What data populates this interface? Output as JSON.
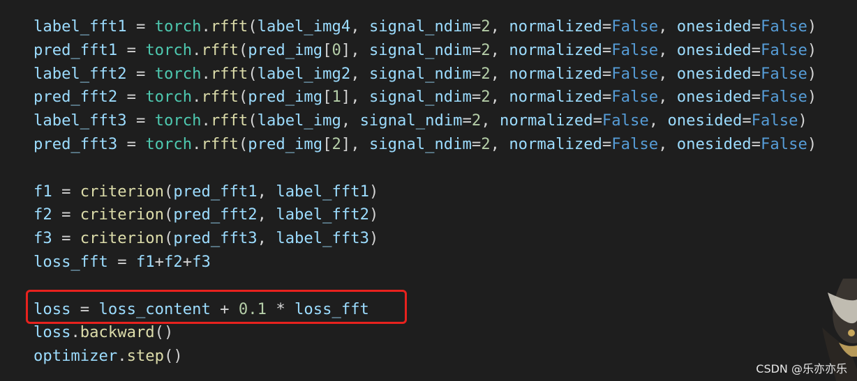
{
  "code": {
    "lines": [
      {
        "tokens": [
          {
            "t": "label_fft1",
            "k": "var"
          },
          {
            "t": " = ",
            "k": "op"
          },
          {
            "t": "torch",
            "k": "mod"
          },
          {
            "t": ".",
            "k": "op"
          },
          {
            "t": "rfft",
            "k": "fn"
          },
          {
            "t": "(",
            "k": "op"
          },
          {
            "t": "label_img4",
            "k": "var"
          },
          {
            "t": ", ",
            "k": "op"
          },
          {
            "t": "signal_ndim",
            "k": "var"
          },
          {
            "t": "=",
            "k": "op"
          },
          {
            "t": "2",
            "k": "num"
          },
          {
            "t": ", ",
            "k": "op"
          },
          {
            "t": "normalized",
            "k": "var"
          },
          {
            "t": "=",
            "k": "op"
          },
          {
            "t": "False",
            "k": "kw"
          },
          {
            "t": ", ",
            "k": "op"
          },
          {
            "t": "onesided",
            "k": "var"
          },
          {
            "t": "=",
            "k": "op"
          },
          {
            "t": "False",
            "k": "kw"
          },
          {
            "t": ")",
            "k": "op"
          }
        ]
      },
      {
        "tokens": [
          {
            "t": "pred_fft1",
            "k": "var"
          },
          {
            "t": " = ",
            "k": "op"
          },
          {
            "t": "torch",
            "k": "mod"
          },
          {
            "t": ".",
            "k": "op"
          },
          {
            "t": "rfft",
            "k": "fn"
          },
          {
            "t": "(",
            "k": "op"
          },
          {
            "t": "pred_img",
            "k": "var"
          },
          {
            "t": "[",
            "k": "op"
          },
          {
            "t": "0",
            "k": "num"
          },
          {
            "t": "], ",
            "k": "op"
          },
          {
            "t": "signal_ndim",
            "k": "var"
          },
          {
            "t": "=",
            "k": "op"
          },
          {
            "t": "2",
            "k": "num"
          },
          {
            "t": ", ",
            "k": "op"
          },
          {
            "t": "normalized",
            "k": "var"
          },
          {
            "t": "=",
            "k": "op"
          },
          {
            "t": "False",
            "k": "kw"
          },
          {
            "t": ", ",
            "k": "op"
          },
          {
            "t": "onesided",
            "k": "var"
          },
          {
            "t": "=",
            "k": "op"
          },
          {
            "t": "False",
            "k": "kw"
          },
          {
            "t": ")",
            "k": "op"
          }
        ]
      },
      {
        "tokens": [
          {
            "t": "label_fft2",
            "k": "var"
          },
          {
            "t": " = ",
            "k": "op"
          },
          {
            "t": "torch",
            "k": "mod"
          },
          {
            "t": ".",
            "k": "op"
          },
          {
            "t": "rfft",
            "k": "fn"
          },
          {
            "t": "(",
            "k": "op"
          },
          {
            "t": "label_img2",
            "k": "var"
          },
          {
            "t": ", ",
            "k": "op"
          },
          {
            "t": "signal_ndim",
            "k": "var"
          },
          {
            "t": "=",
            "k": "op"
          },
          {
            "t": "2",
            "k": "num"
          },
          {
            "t": ", ",
            "k": "op"
          },
          {
            "t": "normalized",
            "k": "var"
          },
          {
            "t": "=",
            "k": "op"
          },
          {
            "t": "False",
            "k": "kw"
          },
          {
            "t": ", ",
            "k": "op"
          },
          {
            "t": "onesided",
            "k": "var"
          },
          {
            "t": "=",
            "k": "op"
          },
          {
            "t": "False",
            "k": "kw"
          },
          {
            "t": ")",
            "k": "op"
          }
        ]
      },
      {
        "tokens": [
          {
            "t": "pred_fft2",
            "k": "var"
          },
          {
            "t": " = ",
            "k": "op"
          },
          {
            "t": "torch",
            "k": "mod"
          },
          {
            "t": ".",
            "k": "op"
          },
          {
            "t": "rfft",
            "k": "fn"
          },
          {
            "t": "(",
            "k": "op"
          },
          {
            "t": "pred_img",
            "k": "var"
          },
          {
            "t": "[",
            "k": "op"
          },
          {
            "t": "1",
            "k": "num"
          },
          {
            "t": "], ",
            "k": "op"
          },
          {
            "t": "signal_ndim",
            "k": "var"
          },
          {
            "t": "=",
            "k": "op"
          },
          {
            "t": "2",
            "k": "num"
          },
          {
            "t": ", ",
            "k": "op"
          },
          {
            "t": "normalized",
            "k": "var"
          },
          {
            "t": "=",
            "k": "op"
          },
          {
            "t": "False",
            "k": "kw"
          },
          {
            "t": ", ",
            "k": "op"
          },
          {
            "t": "onesided",
            "k": "var"
          },
          {
            "t": "=",
            "k": "op"
          },
          {
            "t": "False",
            "k": "kw"
          },
          {
            "t": ")",
            "k": "op"
          }
        ]
      },
      {
        "tokens": [
          {
            "t": "label_fft3",
            "k": "var"
          },
          {
            "t": " = ",
            "k": "op"
          },
          {
            "t": "torch",
            "k": "mod"
          },
          {
            "t": ".",
            "k": "op"
          },
          {
            "t": "rfft",
            "k": "fn"
          },
          {
            "t": "(",
            "k": "op"
          },
          {
            "t": "label_img",
            "k": "var"
          },
          {
            "t": ", ",
            "k": "op"
          },
          {
            "t": "signal_ndim",
            "k": "var"
          },
          {
            "t": "=",
            "k": "op"
          },
          {
            "t": "2",
            "k": "num"
          },
          {
            "t": ", ",
            "k": "op"
          },
          {
            "t": "normalized",
            "k": "var"
          },
          {
            "t": "=",
            "k": "op"
          },
          {
            "t": "False",
            "k": "kw"
          },
          {
            "t": ", ",
            "k": "op"
          },
          {
            "t": "onesided",
            "k": "var"
          },
          {
            "t": "=",
            "k": "op"
          },
          {
            "t": "False",
            "k": "kw"
          },
          {
            "t": ")",
            "k": "op"
          }
        ]
      },
      {
        "tokens": [
          {
            "t": "pred_fft3",
            "k": "var"
          },
          {
            "t": " = ",
            "k": "op"
          },
          {
            "t": "torch",
            "k": "mod"
          },
          {
            "t": ".",
            "k": "op"
          },
          {
            "t": "rfft",
            "k": "fn"
          },
          {
            "t": "(",
            "k": "op"
          },
          {
            "t": "pred_img",
            "k": "var"
          },
          {
            "t": "[",
            "k": "op"
          },
          {
            "t": "2",
            "k": "num"
          },
          {
            "t": "], ",
            "k": "op"
          },
          {
            "t": "signal_ndim",
            "k": "var"
          },
          {
            "t": "=",
            "k": "op"
          },
          {
            "t": "2",
            "k": "num"
          },
          {
            "t": ", ",
            "k": "op"
          },
          {
            "t": "normalized",
            "k": "var"
          },
          {
            "t": "=",
            "k": "op"
          },
          {
            "t": "False",
            "k": "kw"
          },
          {
            "t": ", ",
            "k": "op"
          },
          {
            "t": "onesided",
            "k": "var"
          },
          {
            "t": "=",
            "k": "op"
          },
          {
            "t": "False",
            "k": "kw"
          },
          {
            "t": ")",
            "k": "op"
          }
        ]
      },
      {
        "tokens": []
      },
      {
        "tokens": [
          {
            "t": "f1",
            "k": "var"
          },
          {
            "t": " = ",
            "k": "op"
          },
          {
            "t": "criterion",
            "k": "fn"
          },
          {
            "t": "(",
            "k": "op"
          },
          {
            "t": "pred_fft1",
            "k": "var"
          },
          {
            "t": ", ",
            "k": "op"
          },
          {
            "t": "label_fft1",
            "k": "var"
          },
          {
            "t": ")",
            "k": "op"
          }
        ]
      },
      {
        "tokens": [
          {
            "t": "f2",
            "k": "var"
          },
          {
            "t": " = ",
            "k": "op"
          },
          {
            "t": "criterion",
            "k": "fn"
          },
          {
            "t": "(",
            "k": "op"
          },
          {
            "t": "pred_fft2",
            "k": "var"
          },
          {
            "t": ", ",
            "k": "op"
          },
          {
            "t": "label_fft2",
            "k": "var"
          },
          {
            "t": ")",
            "k": "op"
          }
        ]
      },
      {
        "tokens": [
          {
            "t": "f3",
            "k": "var"
          },
          {
            "t": " = ",
            "k": "op"
          },
          {
            "t": "criterion",
            "k": "fn"
          },
          {
            "t": "(",
            "k": "op"
          },
          {
            "t": "pred_fft3",
            "k": "var"
          },
          {
            "t": ", ",
            "k": "op"
          },
          {
            "t": "label_fft3",
            "k": "var"
          },
          {
            "t": ")",
            "k": "op"
          }
        ]
      },
      {
        "tokens": [
          {
            "t": "loss_fft",
            "k": "var"
          },
          {
            "t": " = ",
            "k": "op"
          },
          {
            "t": "f1",
            "k": "var"
          },
          {
            "t": "+",
            "k": "op"
          },
          {
            "t": "f2",
            "k": "var"
          },
          {
            "t": "+",
            "k": "op"
          },
          {
            "t": "f3",
            "k": "var"
          }
        ]
      },
      {
        "tokens": []
      },
      {
        "tokens": [
          {
            "t": "loss",
            "k": "var"
          },
          {
            "t": " = ",
            "k": "op"
          },
          {
            "t": "loss_content",
            "k": "var"
          },
          {
            "t": " + ",
            "k": "op"
          },
          {
            "t": "0.1",
            "k": "num"
          },
          {
            "t": " * ",
            "k": "op"
          },
          {
            "t": "loss_fft",
            "k": "var"
          }
        ]
      },
      {
        "tokens": [
          {
            "t": "loss",
            "k": "var"
          },
          {
            "t": ".",
            "k": "op"
          },
          {
            "t": "backward",
            "k": "fn"
          },
          {
            "t": "()",
            "k": "op"
          }
        ]
      },
      {
        "tokens": [
          {
            "t": "optimizer",
            "k": "var"
          },
          {
            "t": ".",
            "k": "op"
          },
          {
            "t": "step",
            "k": "fn"
          },
          {
            "t": "()",
            "k": "op"
          }
        ]
      }
    ]
  },
  "highlight": {
    "line_index": 12,
    "color": "#e8221e"
  },
  "watermark": {
    "text": "CSDN @乐亦亦乐"
  },
  "colors": {
    "background": "#1e1e1e",
    "variable": "#9cdcfe",
    "module": "#4ec9b0",
    "function": "#dcdcaa",
    "number": "#b5cea8",
    "keyword": "#569cd6",
    "operator": "#d4d4d4"
  }
}
